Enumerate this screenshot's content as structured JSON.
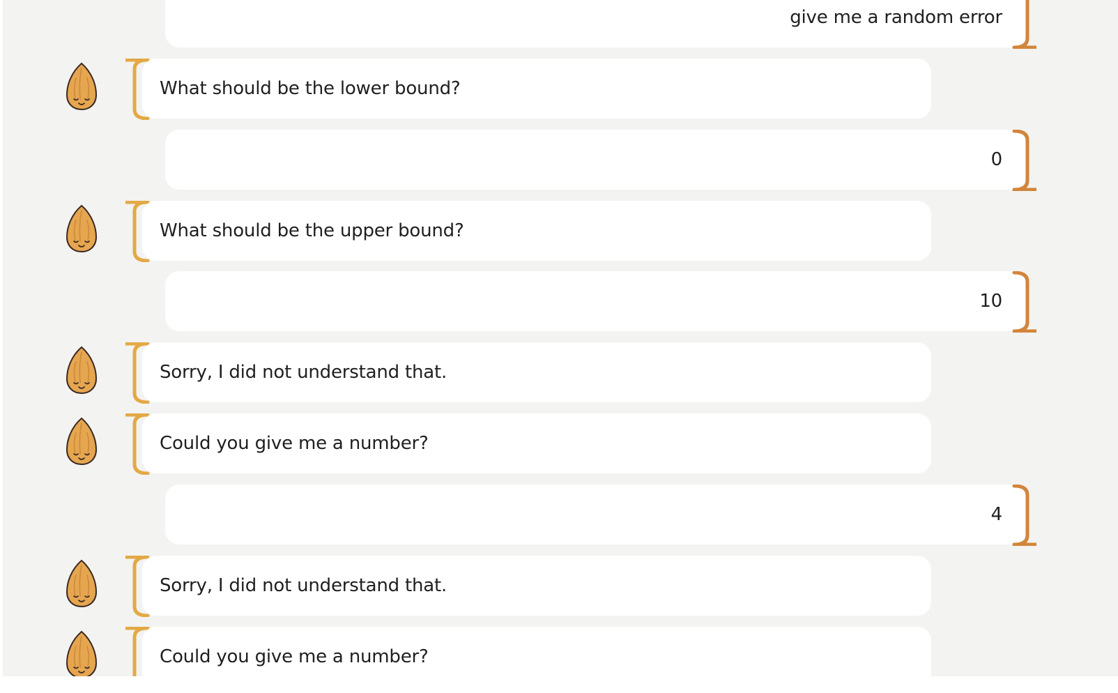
{
  "chat": {
    "bot_avatar_icon": "almond-avatar-icon",
    "colors": {
      "panel_background": "#f3f3f1",
      "bubble_background": "#ffffff",
      "bot_accent": "#e3a945",
      "user_accent": "#d2853b",
      "text": "#1f1f1f"
    },
    "messages": [
      {
        "sender": "user",
        "text": "give me a random error"
      },
      {
        "sender": "bot",
        "text": "What should be the lower bound?"
      },
      {
        "sender": "user",
        "text": "0"
      },
      {
        "sender": "bot",
        "text": "What should be the upper bound?"
      },
      {
        "sender": "user",
        "text": "10"
      },
      {
        "sender": "bot",
        "text": "Sorry, I did not understand that."
      },
      {
        "sender": "bot",
        "text": "Could you give me a number?"
      },
      {
        "sender": "user",
        "text": "4"
      },
      {
        "sender": "bot",
        "text": "Sorry, I did not understand that."
      },
      {
        "sender": "bot",
        "text": "Could you give me a number?"
      }
    ]
  }
}
